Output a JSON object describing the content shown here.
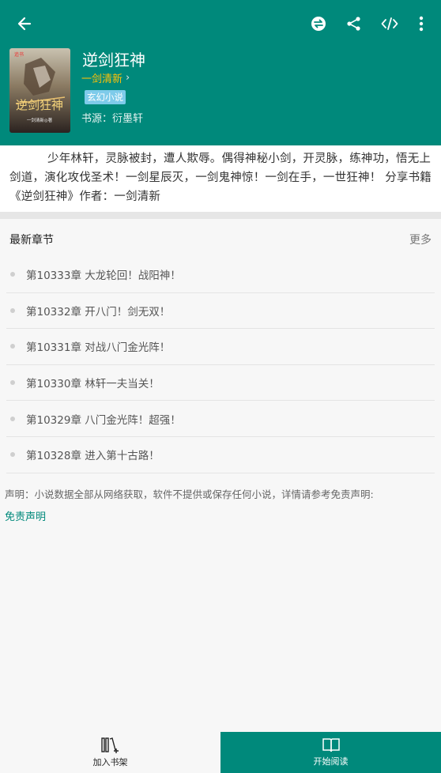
{
  "header": {
    "back_icon": "arrow-left-icon",
    "actions": [
      "swap-source-icon",
      "share-icon",
      "code-icon",
      "more-vert-icon"
    ]
  },
  "book": {
    "title": "逆剑狂神",
    "author": "一剑清新",
    "author_chevron": "›",
    "genre": "玄幻小说",
    "source": "书源：衍墨轩",
    "cover_text": "逆剑狂神",
    "cover_author": "一剑清新◎著"
  },
  "description": "少年林轩，灵脉被封，遭人欺辱。偶得神秘小剑，开灵脉，练神功，悟无上剑道，演化攻伐圣术！一剑星辰灭，一剑鬼神惊！一剑在手，一世狂神！ 分享书籍《逆剑狂神》作者：一剑清新",
  "chapters": {
    "header": "最新章节",
    "more": "更多",
    "items": [
      "第10333章 大龙轮回！战阳神！",
      "第10332章 开八门！剑无双！",
      "第10331章 对战八门金光阵！",
      "第10330章 林轩一夫当关！",
      "第10329章 八门金光阵！超强！",
      "第10328章 进入第十古路！"
    ]
  },
  "notice": "声明：小说数据全部从网络获取，软件不提供或保存任何小说，详情请参考免责声明:",
  "disclaimer": "免责声明",
  "bottom": {
    "shelf_label": "加入书架",
    "read_label": "开始阅读"
  },
  "colors": {
    "primary": "#00897b",
    "author": "#ffc107",
    "genre_tag": "#7ecbea"
  }
}
